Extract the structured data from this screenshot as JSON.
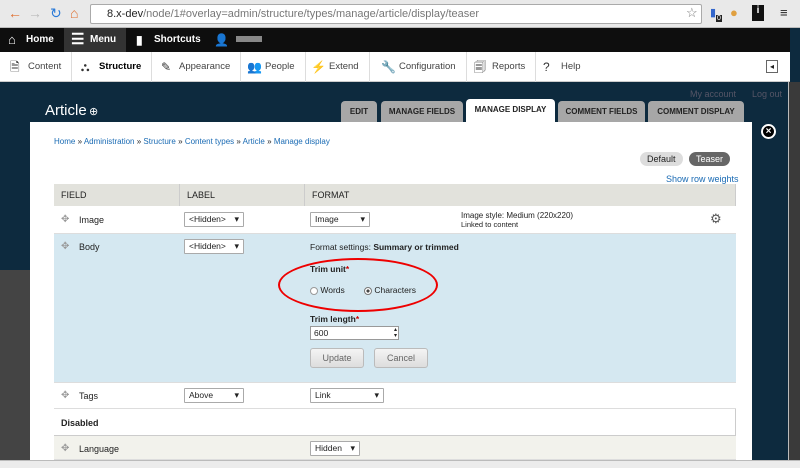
{
  "browser": {
    "url_host": "8.x-dev",
    "url_path": "/node/1#overlay=admin/structure/types/manage/article/display/teaser",
    "ext_badge": "0"
  },
  "toolbar": {
    "home": "Home",
    "menu": "Menu",
    "shortcuts": "Shortcuts"
  },
  "tray": [
    "Content",
    "Structure",
    "Appearance",
    "People",
    "Extend",
    "Configuration",
    "Reports",
    "Help"
  ],
  "page": {
    "title": "Article",
    "my_account": "My account",
    "log_out": "Log out",
    "tabs": [
      "EDIT",
      "MANAGE FIELDS",
      "MANAGE DISPLAY",
      "COMMENT FIELDS",
      "COMMENT DISPLAY"
    ]
  },
  "modal": {
    "breadcrumb": [
      "Home",
      "Administration",
      "Structure",
      "Content types",
      "Article",
      "Manage display"
    ],
    "sep": "»",
    "view_modes": [
      "Default",
      "Teaser"
    ],
    "show_weights": "Show row weights",
    "columns": [
      "FIELD",
      "LABEL",
      "FORMAT"
    ],
    "rows": {
      "image": {
        "field": "Image",
        "label": "<Hidden>",
        "format": "Image",
        "summary1": "Image style: Medium (220x220)",
        "summary2": "Linked to content"
      },
      "body": {
        "field": "Body",
        "label": "<Hidden>",
        "settings_prefix": "Format settings:",
        "settings_name": "Summary or trimmed",
        "trim_unit": "Trim unit",
        "required": "*",
        "opt_words": "Words",
        "opt_chars": "Characters",
        "trim_length": "Trim length",
        "trim_value": "600",
        "update": "Update",
        "cancel": "Cancel"
      },
      "tags": {
        "field": "Tags",
        "label": "Above",
        "format": "Link"
      },
      "disabled": "Disabled",
      "language": {
        "field": "Language",
        "format": "Hidden"
      }
    }
  }
}
